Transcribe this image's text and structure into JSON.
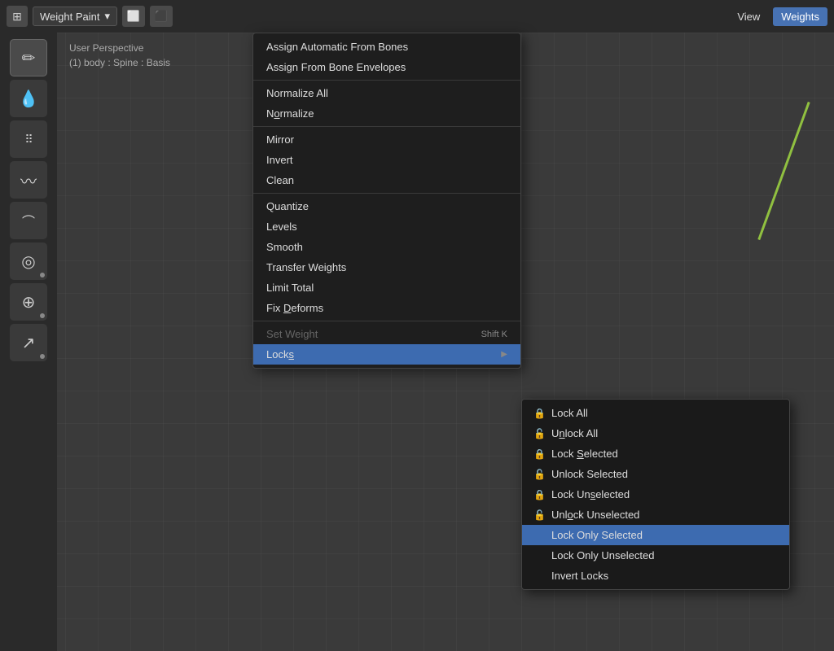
{
  "topbar": {
    "mode": "Weight Paint",
    "view_label": "View",
    "weights_label": "Weights",
    "dropdown_icon": "▾"
  },
  "viewport_header": {
    "line1": "User Perspective",
    "line2": "(1) body : Spine : Basis"
  },
  "tools": [
    {
      "name": "draw",
      "icon": "✏",
      "active": true
    },
    {
      "name": "blur",
      "icon": "💧"
    },
    {
      "name": "dots",
      "icon": "⠿"
    },
    {
      "name": "smear",
      "icon": "≈"
    },
    {
      "name": "relax",
      "icon": "/"
    },
    {
      "name": "sample",
      "icon": "⊙"
    },
    {
      "name": "crosshair",
      "icon": "⊕"
    },
    {
      "name": "gradient",
      "icon": "↗"
    }
  ],
  "weights_menu": {
    "items": [
      {
        "label": "Assign Automatic From Bones",
        "section": 1
      },
      {
        "label": "Assign From Bone Envelopes",
        "section": 1
      },
      {
        "label": "Normalize All",
        "section": 2
      },
      {
        "label": "Normalize",
        "section": 2
      },
      {
        "label": "Mirror",
        "section": 3
      },
      {
        "label": "Invert",
        "section": 3
      },
      {
        "label": "Clean",
        "section": 3
      },
      {
        "label": "Quantize",
        "section": 4
      },
      {
        "label": "Levels",
        "section": 4
      },
      {
        "label": "Smooth",
        "section": 4
      },
      {
        "label": "Transfer Weights",
        "section": 4
      },
      {
        "label": "Limit Total",
        "section": 4
      },
      {
        "label": "Fix Deforms",
        "section": 4
      },
      {
        "label": "Set Weight",
        "shortcut": "Shift K",
        "disabled": true,
        "section": 5
      },
      {
        "label": "Locks",
        "submenu": true,
        "section": 5,
        "active": true
      }
    ]
  },
  "locks_submenu": {
    "items": [
      {
        "label": "Lock All"
      },
      {
        "label": "Unlock All"
      },
      {
        "label": "Lock Selected"
      },
      {
        "label": "Unlock Selected"
      },
      {
        "label": "Lock Unselected"
      },
      {
        "label": "Unlock Unselected"
      },
      {
        "label": "Lock Only Selected",
        "active": true
      },
      {
        "label": "Lock Only Unselected"
      },
      {
        "label": "Invert Locks"
      }
    ]
  },
  "underlines": {
    "Assign Automatic From Bones": 0,
    "Assign From Bone Envelopes": 7,
    "Normalize All": 0,
    "Normalize": 2,
    "Mirror": 0,
    "Invert": 0,
    "Clean": 0,
    "Quantize": 0,
    "Levels": 0,
    "Smooth": 0,
    "Transfer Weights": 0,
    "Limit Total": 0,
    "Fix Deforms": 4,
    "Set Weight": 0,
    "Locks": 4,
    "Lock All": 0,
    "Unlock All": 2,
    "Lock Selected": 5,
    "Unlock Selected": 0,
    "Lock Unselected": 5,
    "Unlock Unselected": 2,
    "Lock Only Selected": 10,
    "Lock Only Unselected": 10,
    "Invert Locks": 0
  }
}
